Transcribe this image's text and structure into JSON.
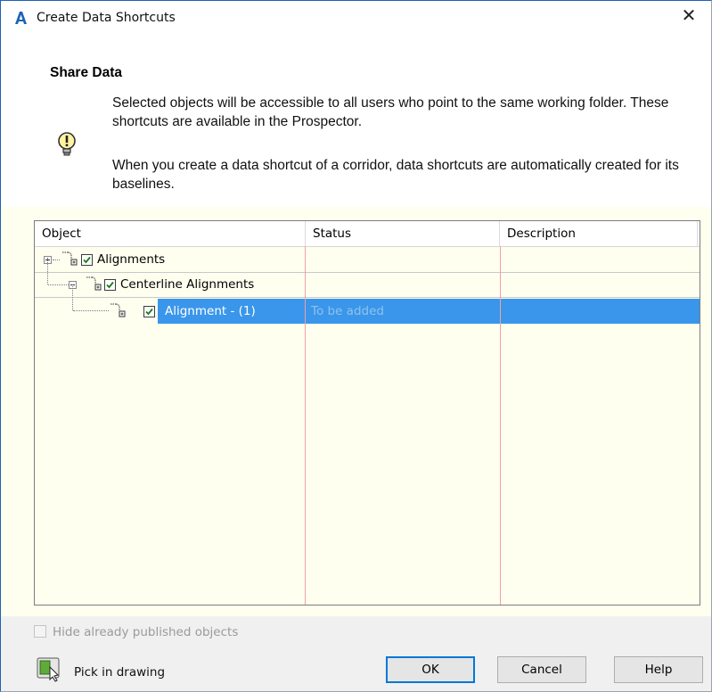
{
  "window": {
    "title": "Create Data Shortcuts",
    "close_icon": "close-icon",
    "app_icon": "autocad-a-icon"
  },
  "header": {
    "title": "Share Data",
    "message1": "Selected objects will be accessible to all users who point to the same working folder. These shortcuts are available in the Prospector.",
    "message2": "When you create a data shortcut of a corridor, data shortcuts are automatically created for its baselines.",
    "info_icon": "lightbulb-icon"
  },
  "table": {
    "columns": [
      "Object",
      "Status",
      "Description"
    ],
    "rows": [
      {
        "label": "Alignments",
        "checked": true,
        "status": "",
        "description": "",
        "level": 0,
        "selected": false
      },
      {
        "label": "Centerline Alignments",
        "checked": true,
        "status": "",
        "description": "",
        "level": 1,
        "selected": false
      },
      {
        "label": "Alignment - (1)",
        "checked": true,
        "status": "To be added",
        "description": "",
        "level": 2,
        "selected": true
      }
    ]
  },
  "footer": {
    "hide_published_label": "Hide already published objects",
    "hide_published_checked": false,
    "pick_label": "Pick in drawing",
    "pick_icon": "pick-in-drawing-icon",
    "ok_label": "OK",
    "cancel_label": "Cancel",
    "help_label": "Help"
  },
  "colors": {
    "selection": "#3a96ea",
    "grid_background": "#fffff0",
    "column_divider": "#f0a0a0",
    "checkmark": "#1a7a1a"
  }
}
